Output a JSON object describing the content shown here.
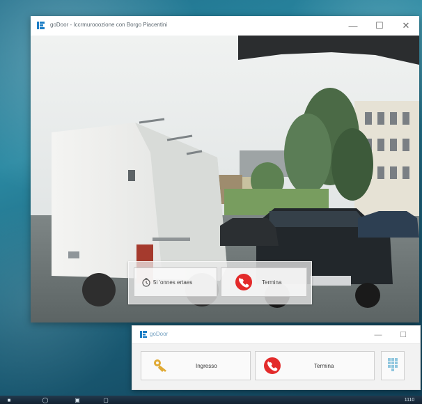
{
  "main_window": {
    "title": "goDoor - Iccrmurooozione con Borgo Piacentini",
    "controls": {
      "minimize": "—",
      "maximize": "☐",
      "close": "✕"
    },
    "overlay": {
      "left_button_label": "5i 'onnes ertaes",
      "right_button_label": "Termina"
    }
  },
  "secondary_window": {
    "title": "goDoor",
    "controls": {
      "minimize": "—",
      "maximize": "☐"
    },
    "buttons": {
      "ingresso": "Ingresso",
      "termina": "Termina"
    }
  },
  "taskbar": {
    "clock": "1110",
    "icons": [
      "start-icon",
      "search-icon",
      "app-icon",
      "window-icon"
    ]
  },
  "colors": {
    "phone_red": "#e32b2b",
    "accent_blue": "#1f6f8b",
    "key_gold": "#e0aa35",
    "keypad_blue": "#8fc6de"
  },
  "icons": {
    "app_logo": "app-logo-icon",
    "timer": "timer-icon",
    "phone": "phone-icon",
    "key": "key-icon",
    "keypad": "keypad-icon"
  }
}
